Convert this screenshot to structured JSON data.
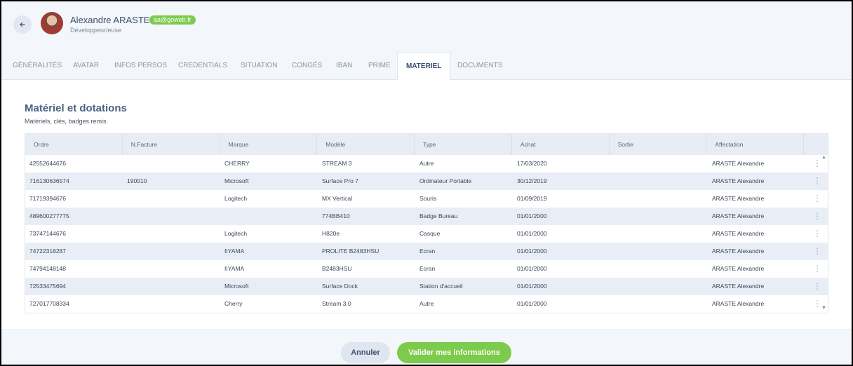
{
  "header": {
    "user_name": "Alexandre ARASTE",
    "email": "aa@goweb.fr",
    "role": "Développeur/euse"
  },
  "tabs": [
    {
      "label": "GÉNÉRALITÉS"
    },
    {
      "label": "AVATAR"
    },
    {
      "label": "INFOS PERSOS"
    },
    {
      "label": "CREDENTIALS"
    },
    {
      "label": "SITUATION"
    },
    {
      "label": "CONGÉS"
    },
    {
      "label": "IBAN"
    },
    {
      "label": "PRIME"
    },
    {
      "label": "MATERIEL"
    },
    {
      "label": "DOCUMENTS"
    }
  ],
  "active_tab": "MATERIEL",
  "section": {
    "title": "Matériel et dotations",
    "subtitle": "Matériels, clés, badges remis."
  },
  "table": {
    "columns": [
      "Ordre",
      "N.Facture",
      "Marque",
      "Modèle",
      "Type",
      "Achat",
      "Sortie",
      "Affectation"
    ],
    "rows": [
      [
        "42552644676",
        "",
        "CHERRY",
        "STREAM 3",
        "Autre",
        "17/03/2020",
        "",
        "ARASTE Alexandre"
      ],
      [
        "716130636574",
        "190010",
        "Microsoft",
        "Surface Pro 7",
        "Ordinateur Portable",
        "30/12/2019",
        "",
        "ARASTE Alexandre"
      ],
      [
        "71719394676",
        "",
        "Logitech",
        "MX Vertical",
        "Souris",
        "01/09/2019",
        "",
        "ARASTE Alexandre"
      ],
      [
        "489600277775",
        "",
        "",
        "774BB410",
        "Badge Bureau",
        "01/01/2000",
        "",
        "ARASTE Alexandre"
      ],
      [
        "73747144676",
        "",
        "Logitech",
        "H820e",
        "Casque",
        "01/01/2000",
        "",
        "ARASTE Alexandre"
      ],
      [
        "74722318287",
        "",
        "IIYAMA",
        "PROLITE B2483HSU",
        "Ecran",
        "01/01/2000",
        "",
        "ARASTE Alexandre"
      ],
      [
        "74794148148",
        "",
        "IIYAMA",
        "B2483HSU",
        "Ecran",
        "01/01/2000",
        "",
        "ARASTE Alexandre"
      ],
      [
        "72533475694",
        "",
        "Microsoft",
        "Surface Dock",
        "Station d'accueil",
        "01/01/2000",
        "",
        "ARASTE Alexandre"
      ],
      [
        "727017708334",
        "",
        "Cherry",
        "Stream 3.0",
        "Autre",
        "01/01/2000",
        "",
        "ARASTE Alexandre"
      ]
    ]
  },
  "footer": {
    "cancel_label": "Annuler",
    "validate_label": "Valider mes informations"
  },
  "colors": {
    "accent_green": "#7ccb4c",
    "title_blue": "#4d6283",
    "row_alt": "#e9eef6"
  }
}
